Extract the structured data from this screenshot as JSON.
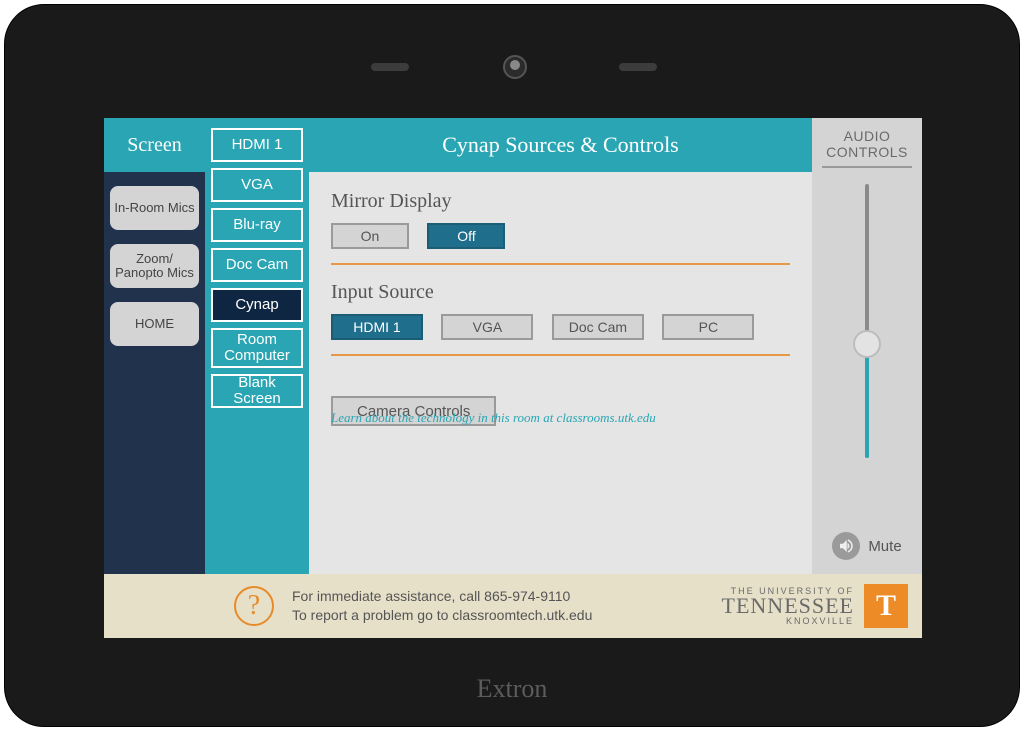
{
  "device_brand": "Extron",
  "nav": {
    "header": "Screen",
    "items": [
      "In-Room Mics",
      "Zoom/\nPanopto Mics",
      "HOME"
    ]
  },
  "sources": {
    "items": [
      "HDMI 1",
      "VGA",
      "Blu-ray",
      "Doc Cam",
      "Cynap",
      "Room Computer",
      "Blank Screen"
    ],
    "active_index": 4
  },
  "main": {
    "title": "Cynap Sources & Controls",
    "mirror": {
      "label": "Mirror Display",
      "options": [
        "On",
        "Off"
      ],
      "active_index": 1
    },
    "input": {
      "label": "Input Source",
      "options": [
        "HDMI 1",
        "VGA",
        "Doc Cam",
        "PC"
      ],
      "active_index": 0
    },
    "camera_button": "Camera Controls",
    "learn_text": "Learn about the technology in this room at classrooms.utk.edu"
  },
  "audio": {
    "title": "AUDIO CONTROLS",
    "mute_label": "Mute"
  },
  "footer": {
    "line1": "For immediate assistance, call 865-974-9110",
    "line2": "To report a problem go to classroomtech.utk.edu",
    "university": {
      "line1": "THE UNIVERSITY OF",
      "line2": "TENNESSEE",
      "line3": "KNOXVILLE",
      "t": "T"
    }
  }
}
